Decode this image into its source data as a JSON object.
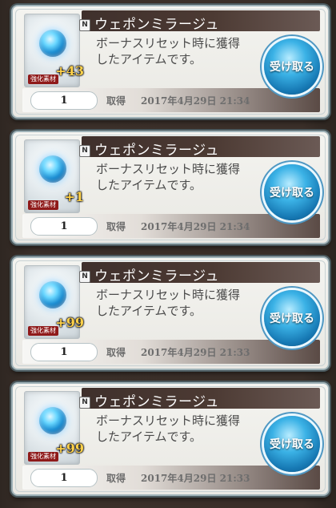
{
  "items": [
    {
      "name": "ウェポンミラージュ",
      "badge": "+43",
      "tag": "強化素材",
      "n_label": "N",
      "desc_lines": [
        "ボーナスリセット時に獲得",
        "したアイテムです。"
      ],
      "quantity": "1",
      "acquired_label": "取得",
      "acquired_at": "2017年4月29日 21:34",
      "button_label": "受け取る"
    },
    {
      "name": "ウェポンミラージュ",
      "badge": "+1",
      "tag": "強化素材",
      "n_label": "N",
      "desc_lines": [
        "ボーナスリセット時に獲得",
        "したアイテムです。"
      ],
      "quantity": "1",
      "acquired_label": "取得",
      "acquired_at": "2017年4月29日 21:34",
      "button_label": "受け取る"
    },
    {
      "name": "ウェポンミラージュ",
      "badge": "+99",
      "tag": "強化素材",
      "n_label": "N",
      "desc_lines": [
        "ボーナスリセット時に獲得",
        "したアイテムです。"
      ],
      "quantity": "1",
      "acquired_label": "取得",
      "acquired_at": "2017年4月29日 21:33",
      "button_label": "受け取る"
    },
    {
      "name": "ウェポンミラージュ",
      "badge": "+99",
      "tag": "強化素材",
      "n_label": "N",
      "desc_lines": [
        "ボーナスリセット時に獲得",
        "したアイテムです。"
      ],
      "quantity": "1",
      "acquired_label": "取得",
      "acquired_at": "2017年4月29日 21:33",
      "button_label": "受け取る"
    }
  ],
  "colors": {
    "accent_blue": "#1d8fd3",
    "badge_gold": "#ffd24a",
    "tag_red": "#8f1a1a",
    "header_brown": "#3f302c"
  },
  "icons": {
    "item_orb": "weapon-mirage-orb-icon"
  }
}
